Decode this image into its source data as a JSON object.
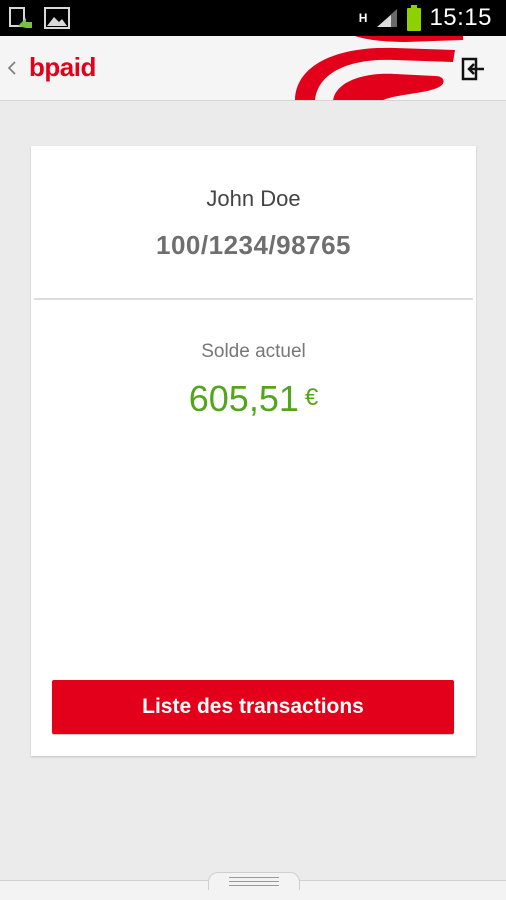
{
  "status_bar": {
    "time": "15:15",
    "network_type": "H",
    "icons": [
      "upload-notification-icon",
      "image-notification-icon",
      "network-h-icon",
      "signal-icon",
      "battery-icon"
    ],
    "battery_color": "#8ed100"
  },
  "app_bar": {
    "title": "bpaid",
    "back_icon": "chevron-left-icon",
    "logout_icon": "logout-icon",
    "brand_color": "#e2001a"
  },
  "account": {
    "holder_name": "John Doe",
    "number": "100/1234/98765"
  },
  "balance": {
    "label": "Solde actuel",
    "amount": "605,51",
    "currency": "€",
    "color": "#55a51c"
  },
  "actions": {
    "transactions_label": "Liste des transactions"
  }
}
